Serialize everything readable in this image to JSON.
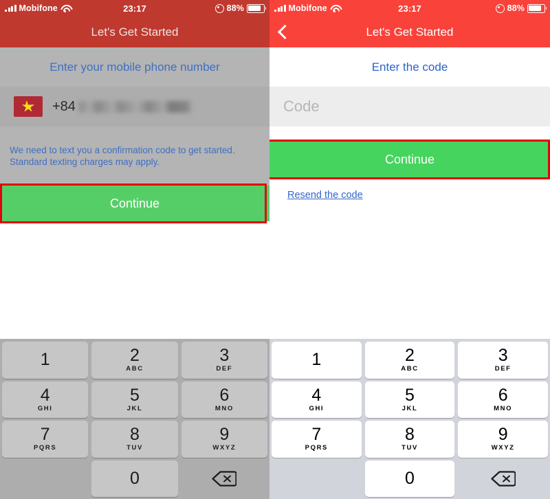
{
  "status_bar": {
    "carrier": "Mobifone",
    "time": "23:17",
    "battery_percent": "88%",
    "signal_icon": "signal-bars-icon",
    "wifi_icon": "wifi-icon",
    "orientation_lock_icon": "orientation-lock-icon",
    "battery_icon": "battery-icon"
  },
  "left_screen": {
    "nav_title": "Let's Get Started",
    "heading": "Enter your mobile phone number",
    "country_flag": "vietnam-flag-icon",
    "dial_code": "+84",
    "phone_number": "",
    "help_text_line1": "We need to text you a confirmation code to get started.",
    "help_text_line2": "Standard texting charges may apply.",
    "continue_label": "Continue"
  },
  "right_screen": {
    "back_icon": "back-chevron-icon",
    "nav_title": "Let's Get Started",
    "heading": "Enter the code",
    "code_placeholder": "Code",
    "code_value": "",
    "continue_label": "Continue",
    "resend_label": "Resend the code"
  },
  "keypad": {
    "keys": [
      {
        "digit": "1",
        "letters": ""
      },
      {
        "digit": "2",
        "letters": "ABC"
      },
      {
        "digit": "3",
        "letters": "DEF"
      },
      {
        "digit": "4",
        "letters": "GHI"
      },
      {
        "digit": "5",
        "letters": "JKL"
      },
      {
        "digit": "6",
        "letters": "MNO"
      },
      {
        "digit": "7",
        "letters": "PQRS"
      },
      {
        "digit": "8",
        "letters": "TUV"
      },
      {
        "digit": "9",
        "letters": "WXYZ"
      },
      {
        "digit": "0",
        "letters": ""
      }
    ],
    "delete_icon": "backspace-delete-icon"
  },
  "annotations": {
    "highlight_color": "#E3000F",
    "boxes": [
      "left-continue-button-highlight",
      "right-continue-button-highlight"
    ]
  },
  "colors": {
    "nav_red": "#F9423A",
    "nav_red_dimmed": "#C0392E",
    "cta_green": "#45D45E",
    "link_blue": "#3366CC",
    "heading_blue": "#2A63C6",
    "keypad_bg": "#D1D4DA"
  }
}
